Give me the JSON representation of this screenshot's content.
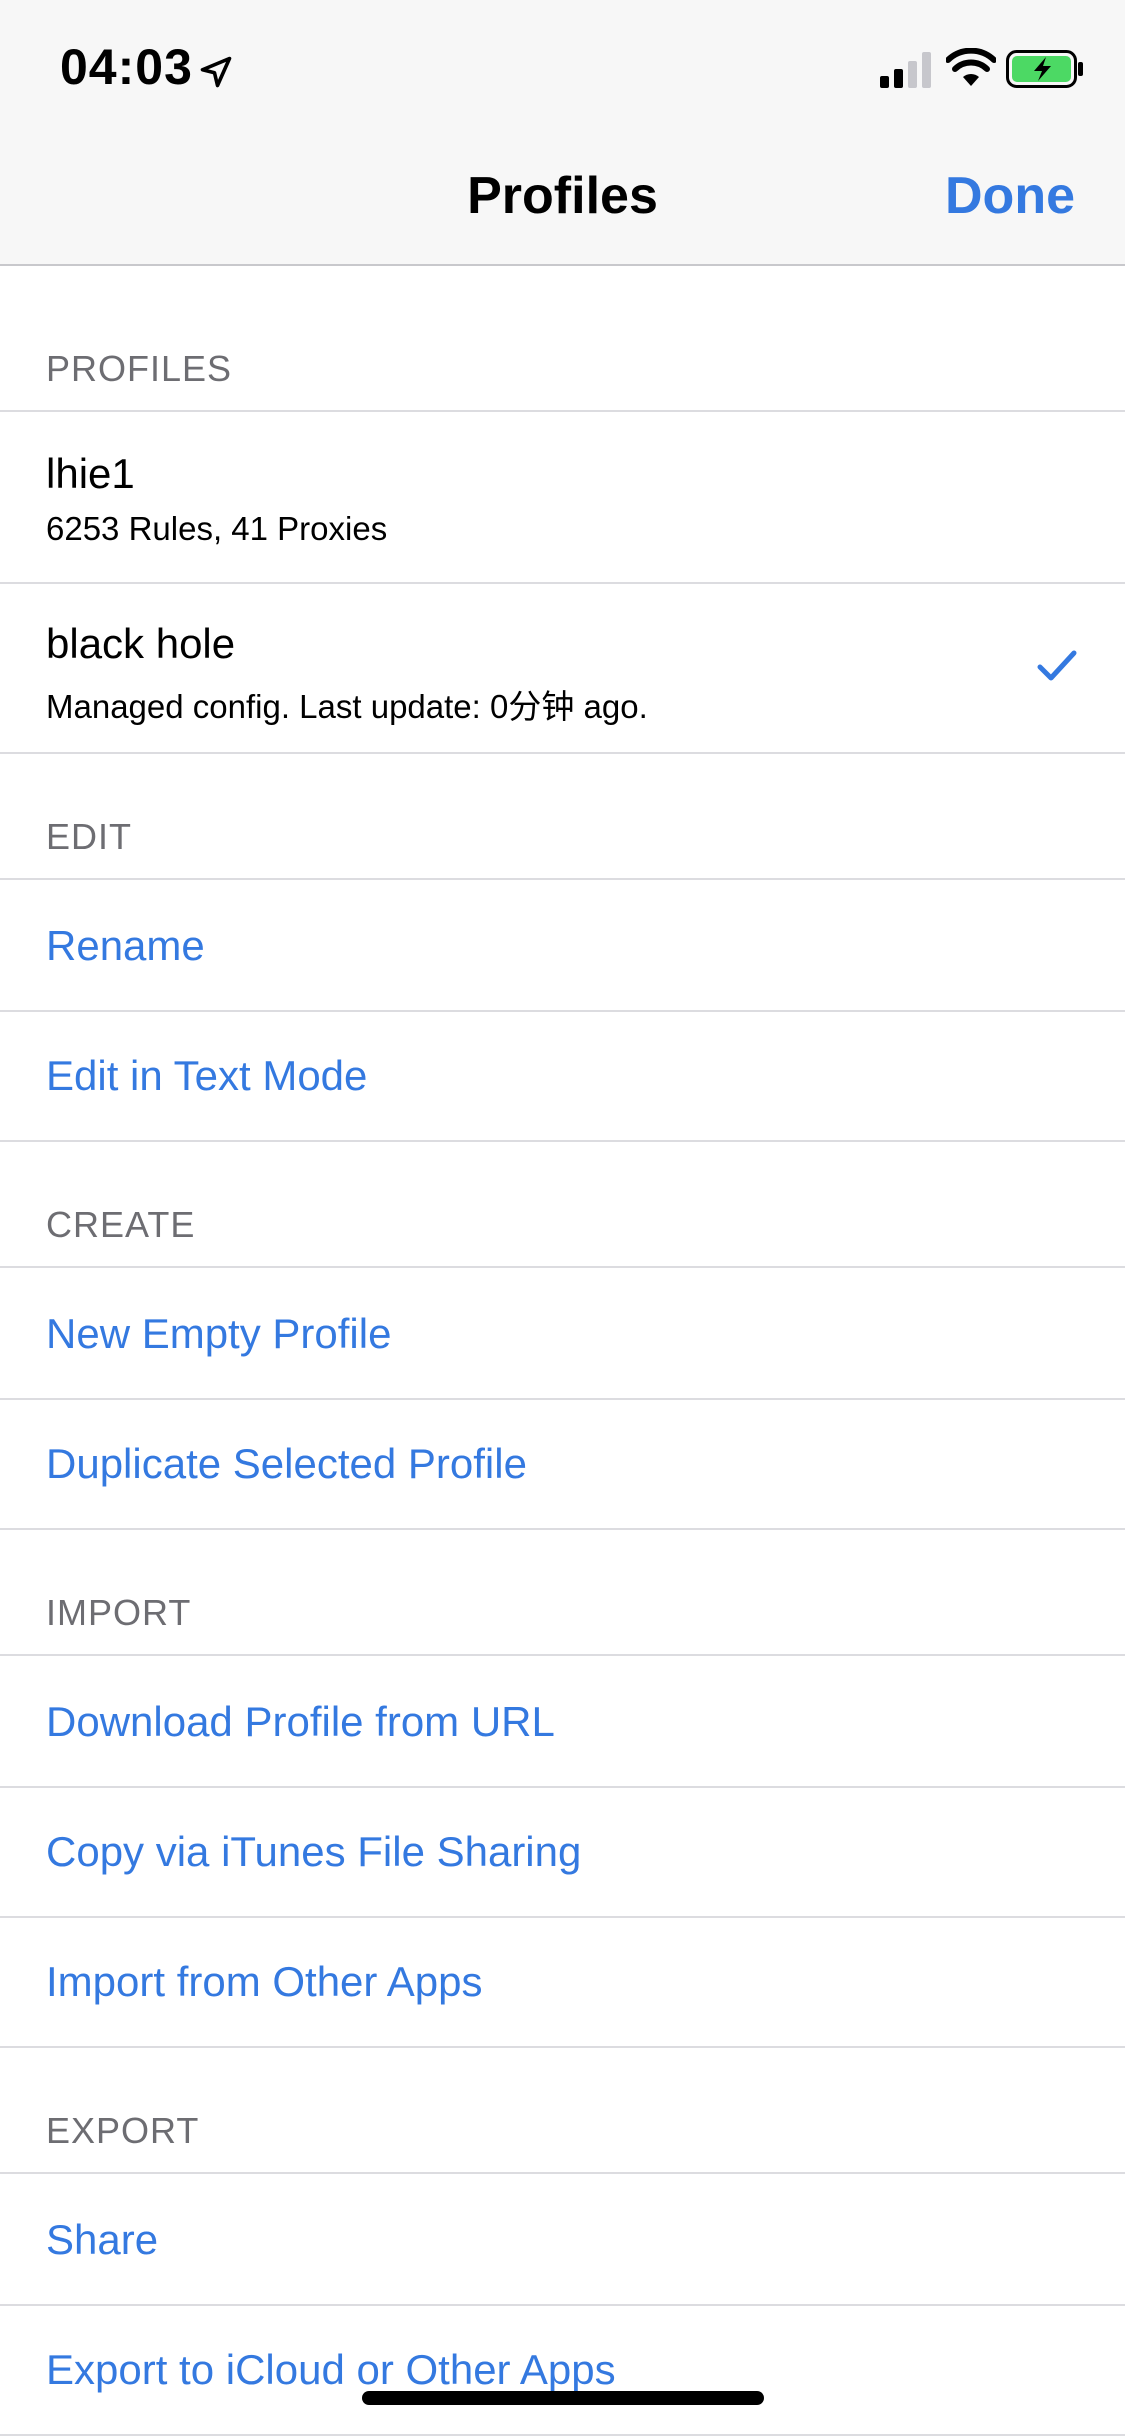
{
  "status_bar": {
    "time": "04:03",
    "icons": [
      "location-arrow-icon",
      "cellular-signal-icon",
      "wifi-icon",
      "battery-charging-icon"
    ],
    "battery_color": "#4cd964"
  },
  "nav": {
    "title": "Profiles",
    "done_label": "Done"
  },
  "colors": {
    "accent": "#3479e0",
    "section_header": "#6d6d72",
    "separator": "#dcdce0"
  },
  "sections": {
    "profiles": {
      "header": "PROFILES",
      "items": [
        {
          "name": "lhie1",
          "subtitle": "6253 Rules, 41 Proxies",
          "selected": false
        },
        {
          "name": "black hole",
          "subtitle": "Managed config. Last update: 0分钟 ago.",
          "selected": true
        }
      ]
    },
    "edit": {
      "header": "EDIT",
      "items": [
        "Rename",
        "Edit in Text Mode"
      ]
    },
    "create": {
      "header": "CREATE",
      "items": [
        "New Empty Profile",
        "Duplicate Selected Profile"
      ]
    },
    "import": {
      "header": "IMPORT",
      "items": [
        "Download Profile from URL",
        "Copy via iTunes File Sharing",
        "Import from Other Apps"
      ]
    },
    "export": {
      "header": "EXPORT",
      "items": [
        "Share",
        "Export to iCloud or Other Apps"
      ]
    }
  }
}
